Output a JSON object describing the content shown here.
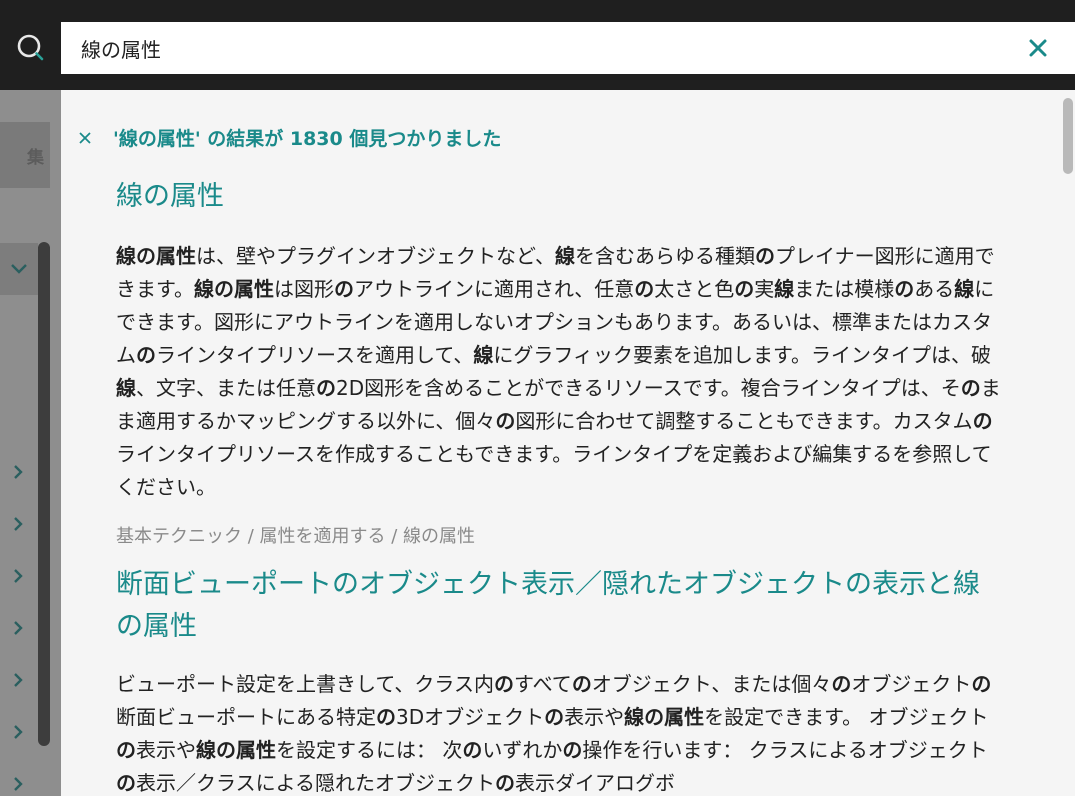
{
  "search": {
    "value": "線の属性"
  },
  "sidebar": {
    "tab_label": "集"
  },
  "summary": {
    "text": "'線の属性' の結果が 1830 個見つかりました"
  },
  "results": [
    {
      "title": "線の属性",
      "body_html": "<b>線の属性</b>は、壁やプラグインオブジェクトなど、<b>線</b>を含むあらゆる種類<b>の</b>プレイナー図形に適用できます。<b>線の属性</b>は図形<b>の</b>アウトラインに適用され、任意<b>の</b>太さと色<b>の</b>実<b>線</b>または模様<b>の</b>ある<b>線</b>にできます。図形にアウトラインを適用しないオプションもあります。あるいは、標準またはカスタム<b>の</b>ラインタイプリソースを適用して、<b>線</b>にグラフィック要素を追加します。ラインタイプは、破<b>線</b>、文字、または任意<b>の</b>2D図形を含めることができるリソースです。複合ラインタイプは、そ<b>の</b>まま適用するかマッピングする以外に、個々<b>の</b>図形に合わせて調整することもできます。カスタム<b>の</b>ラインタイプリソースを作成することもできます。ラインタイプを定義および編集するを参照してください。",
      "breadcrumb": "基本テクニック / 属性を適用する / 線の属性"
    },
    {
      "title": "断面ビューポートのオブジェクト表示／隠れたオブジェクトの表示と線の属性",
      "body_html": "ビューポート設定を上書きして、クラス内<b>の</b>すべて<b>の</b>オブジェクト、または個々<b>の</b>オブジェクト<b>の</b>断面ビューポートにある特定<b>の</b>3Dオブジェクト<b>の</b>表示や<b>線の属性</b>を設定できます。 オブジェクト<b>の</b>表示や<b>線の属性</b>を設定するには： 次<b>の</b>いずれか<b>の</b>操作を行います： クラスによるオブジェクト<b>の</b>表示／クラスによる隠れたオブジェクト<b>の</b>表示ダイアログボ"
    }
  ],
  "colors": {
    "accent": "#1a8a8a",
    "topbar": "#1f1f1f",
    "overlay": "#8a8a8a",
    "panel": "#f5f5f5"
  }
}
